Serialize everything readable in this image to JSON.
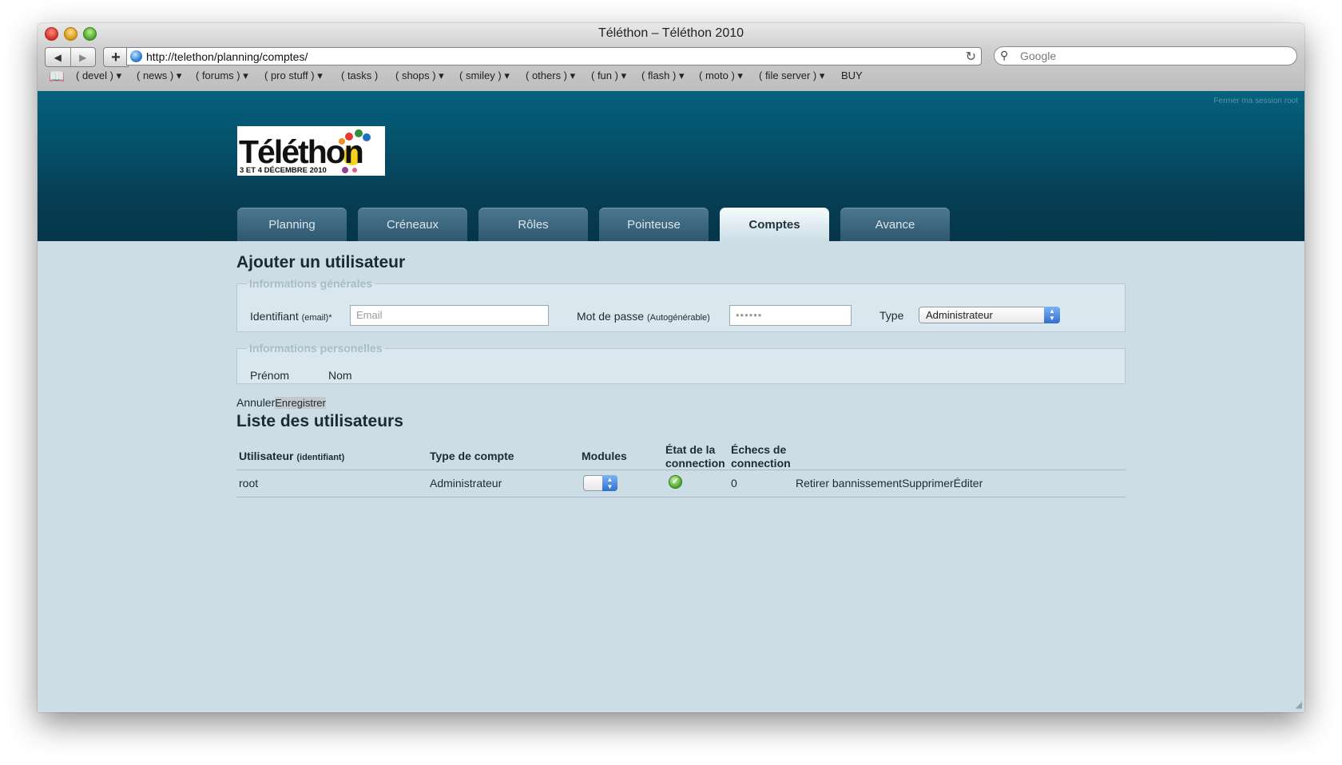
{
  "browser": {
    "title": "Téléthon – Téléthon 2010",
    "back_icon": "◀",
    "forward_icon": "▶",
    "add_icon": "+",
    "url": "http://telethon/planning/comptes/",
    "reload_icon": "↻",
    "search_icon": "⚲",
    "search_placeholder": "Google",
    "bookmarks_icon": "📖",
    "bookmarks": [
      "( devel ) ▾",
      "( news ) ▾",
      "( forums ) ▾",
      "( pro stuff ) ▾",
      "( tasks )",
      "( shops ) ▾",
      "( smiley ) ▾",
      "( others ) ▾",
      "( fun ) ▾",
      "( flash ) ▾",
      "( moto ) ▾",
      "( file server ) ▾",
      "BUY"
    ]
  },
  "header": {
    "logout": "Fermer ma session root",
    "logo_text": "Téléthon",
    "logo_subtitle": "3 ET 4 DÉCEMBRE 2010",
    "tabs": [
      "Planning",
      "Créneaux",
      "Rôles",
      "Pointeuse",
      "Comptes",
      "Avance"
    ],
    "active_tab": "Comptes"
  },
  "form": {
    "title": "Ajouter un utilisateur",
    "general_legend": "Informations générales",
    "id_label": "Identifiant",
    "id_label_small": "(email)*",
    "id_placeholder": "Email",
    "password_label": "Mot de passe",
    "password_label_small": "(Autogénérable)",
    "password_value": "••••••",
    "type_label": "Type",
    "type_value": "Administrateur",
    "personal_legend": "Informations personelles",
    "firstname_label": "Prénom",
    "lastname_label": "Nom",
    "cancel": "Annuler",
    "save": "Enregistrer"
  },
  "list": {
    "title": "Liste des utilisateurs",
    "headers": {
      "user": "Utilisateur",
      "user_small": "(identifiant)",
      "account_type": "Type de compte",
      "modules": "Modules",
      "state_1": "État de la",
      "state_2": "connection",
      "failures_1": "Échecs de",
      "failures_2": "connection"
    },
    "rows": [
      {
        "user": "root",
        "account_type": "Administrateur",
        "failures": "0",
        "unban": "Retirer bannissement",
        "delete": "Supprimer",
        "edit": "Éditer"
      }
    ]
  },
  "colors": {
    "header": "#063f55",
    "content_bg": "#cddde6",
    "tab": "#3a657c",
    "accent_select": "#2f6fd0"
  }
}
